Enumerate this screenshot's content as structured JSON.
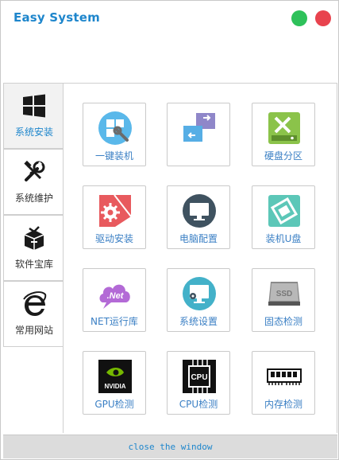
{
  "app": {
    "title": "Easy System"
  },
  "window_controls": {
    "minimize_color": "#2ec15a",
    "close_color": "#e8434e"
  },
  "sidebar": {
    "items": [
      {
        "label": "系统安装",
        "icon": "windows-logo-icon",
        "active": true
      },
      {
        "label": "系统维护",
        "icon": "tools-icon",
        "active": false
      },
      {
        "label": "软件宝库",
        "icon": "gift-box-icon",
        "active": false
      },
      {
        "label": "常用网站",
        "icon": "internet-explorer-icon",
        "active": false
      }
    ]
  },
  "tiles": [
    {
      "label": "一键装机",
      "icon": "wrench-install-icon"
    },
    {
      "label": "",
      "icon": "window-transfer-icon"
    },
    {
      "label": "硬盘分区",
      "icon": "disk-partition-icon"
    },
    {
      "label": "驱动安装",
      "icon": "driver-gear-icon"
    },
    {
      "label": "电脑配置",
      "icon": "monitor-icon"
    },
    {
      "label": "装机U盘",
      "icon": "usb-drive-icon"
    },
    {
      "label": "NET运行库",
      "icon": "net-cloud-icon"
    },
    {
      "label": "系统设置",
      "icon": "monitor-settings-icon"
    },
    {
      "label": "固态检测",
      "icon": "ssd-icon"
    },
    {
      "label": "GPU检测",
      "icon": "nvidia-icon"
    },
    {
      "label": "CPU检测",
      "icon": "cpu-chip-icon"
    },
    {
      "label": "内存检测",
      "icon": "memory-stick-icon"
    }
  ],
  "footer": {
    "close_label": "close the window"
  },
  "colors": {
    "accent": "#1e86cc"
  }
}
